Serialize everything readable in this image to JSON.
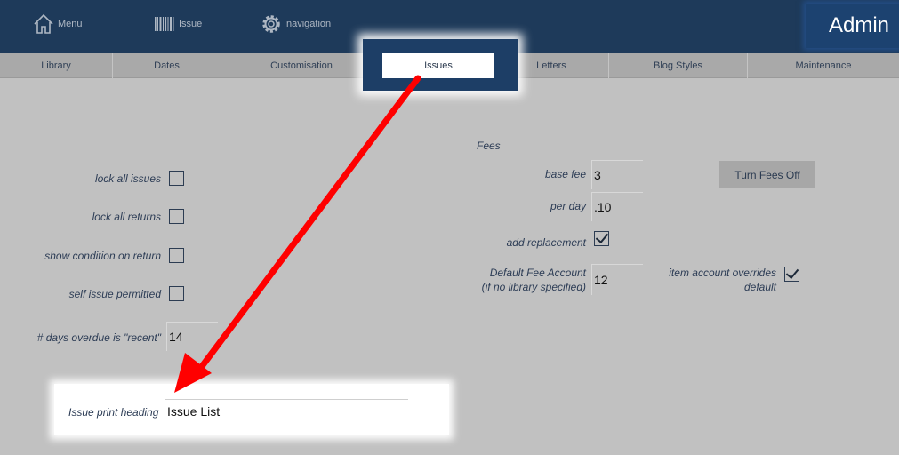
{
  "topbar": {
    "menu_label": "Menu",
    "issue_label": "Issue",
    "navigation_label": "navigation",
    "admin_label": "Admin"
  },
  "tabs": [
    {
      "label": "Library"
    },
    {
      "label": "Dates"
    },
    {
      "label": "Customisation"
    },
    {
      "label": "Issues"
    },
    {
      "label": "Letters"
    },
    {
      "label": "Blog Styles"
    },
    {
      "label": "Maintenance"
    }
  ],
  "active_tab": "Issues",
  "left_form": {
    "lock_all_issues": {
      "label": "lock all issues",
      "checked": false
    },
    "lock_all_returns": {
      "label": "lock all returns",
      "checked": false
    },
    "show_condition_on_return": {
      "label": "show condition on return",
      "checked": false
    },
    "self_issue_permitted": {
      "label": "self issue permitted",
      "checked": false
    },
    "days_overdue": {
      "label": "# days overdue is \"recent\"",
      "value": "14"
    }
  },
  "fees": {
    "heading": "Fees",
    "base_fee": {
      "label": "base fee",
      "value": "3"
    },
    "per_day": {
      "label": "per day",
      "value": ".10"
    },
    "add_replacement": {
      "label": "add replacement",
      "checked": true
    },
    "default_fee_account": {
      "label_line1": "Default Fee Account",
      "label_line2": "(if no library specified)",
      "value": "12"
    },
    "item_account_overrides": {
      "label_line1": "item account overrides",
      "label_line2": "default",
      "checked": true
    },
    "turn_fees_off_label": "Turn Fees Off"
  },
  "issue_print_heading": {
    "label": "Issue print heading",
    "value": "Issue List"
  },
  "colors": {
    "topbar": "#1e3a5a",
    "page_background": "#c1c1c1",
    "tabbar": "#a9a9a9",
    "annotation_arrow": "#ff0000"
  }
}
